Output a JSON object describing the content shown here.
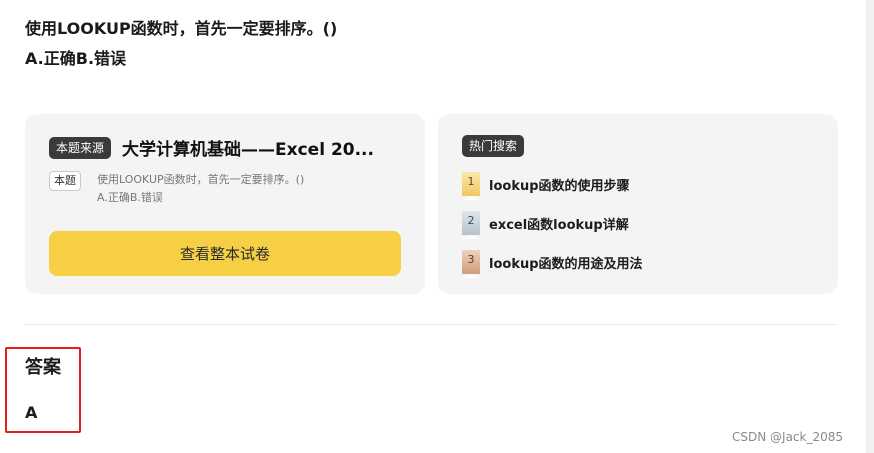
{
  "question": {
    "stem": "使用LOOKUP函数时，首先一定要排序。()",
    "options": "A.正确B.错误"
  },
  "source_card": {
    "tag": "本题来源",
    "title": "大学计算机基础——Excel 20...",
    "mini_tag": "本题",
    "preview_line1": "使用LOOKUP函数时，首先一定要排序。()",
    "preview_line2": "A.正确B.错误",
    "button_label": "查看整本试卷"
  },
  "hot_card": {
    "tag": "热门搜索",
    "items": [
      {
        "rank": "1",
        "label": "lookup函数的使用步骤"
      },
      {
        "rank": "2",
        "label": "excel函数lookup详解"
      },
      {
        "rank": "3",
        "label": "lookup函数的用途及用法"
      }
    ]
  },
  "answer": {
    "title": "答案",
    "value": "A"
  },
  "watermark": "CSDN @Jack_2085",
  "colors": {
    "button": "#f6cf45",
    "tag_bg": "#3a3a3a",
    "card_bg": "#f4f4f4",
    "highlight_border": "#e0201b"
  }
}
